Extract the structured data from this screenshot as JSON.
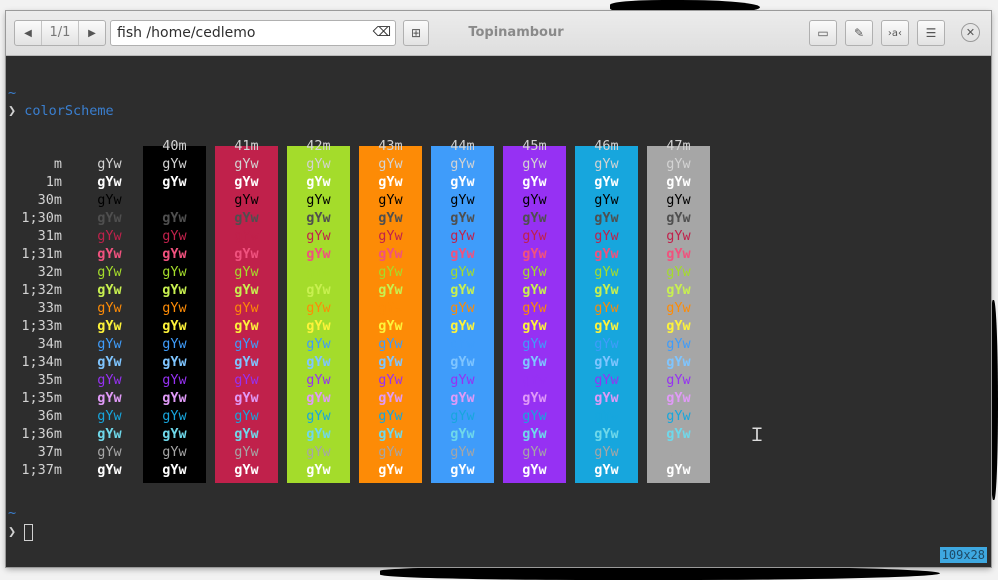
{
  "window": {
    "title": "Topinambour",
    "tab_counter": "1/1",
    "path": "fish  /home/cedlemo",
    "terminal_size": "109x28"
  },
  "icons": {
    "prev": "chevron-left-icon",
    "next": "chevron-right-icon",
    "clear": "backspace-clear-icon",
    "new_tab": "new-tab-icon",
    "overview": "terminal-overview-icon",
    "color_picker": "color-picker-icon",
    "fonts": "font-selector-icon",
    "menu": "hamburger-menu-icon",
    "close": "close-icon"
  },
  "terminal": {
    "prompt_dir": "~",
    "prompt_symbol": "❯",
    "command": "colorScheme",
    "sample_text": "gYw",
    "bg_headers": [
      "40m",
      "41m",
      "42m",
      "43m",
      "44m",
      "45m",
      "46m",
      "47m"
    ],
    "bg_colors": [
      "#000000",
      "#c0214b",
      "#a4dc2b",
      "#fd8b06",
      "#3f9cfa",
      "#9631f3",
      "#17a6dd",
      "#a6a6a6"
    ],
    "rows": [
      {
        "label": "m",
        "fg": "#d3d3d3",
        "bold": false
      },
      {
        "label": "1m",
        "fg": "#ffffff",
        "bold": true
      },
      {
        "label": "30m",
        "fg": "#000000",
        "bold": false
      },
      {
        "label": "1;30m",
        "fg": "#4f4f4f",
        "bold": true
      },
      {
        "label": "31m",
        "fg": "#c0214b",
        "bold": false
      },
      {
        "label": "1;31m",
        "fg": "#f0527e",
        "bold": true
      },
      {
        "label": "32m",
        "fg": "#a4dc2b",
        "bold": false
      },
      {
        "label": "1;32m",
        "fg": "#c8f050",
        "bold": true
      },
      {
        "label": "33m",
        "fg": "#fd8b06",
        "bold": false
      },
      {
        "label": "1;33m",
        "fg": "#fdf33a",
        "bold": true
      },
      {
        "label": "34m",
        "fg": "#3f9cfa",
        "bold": false
      },
      {
        "label": "1;34m",
        "fg": "#7fc5ff",
        "bold": true
      },
      {
        "label": "35m",
        "fg": "#9631f3",
        "bold": false
      },
      {
        "label": "1;35m",
        "fg": "#e09af7",
        "bold": true
      },
      {
        "label": "36m",
        "fg": "#17a6dd",
        "bold": false
      },
      {
        "label": "1;36m",
        "fg": "#6fd8ea",
        "bold": true
      },
      {
        "label": "37m",
        "fg": "#a6a6a6",
        "bold": false
      },
      {
        "label": "1;37m",
        "fg": "#ffffff",
        "bold": true
      }
    ]
  }
}
